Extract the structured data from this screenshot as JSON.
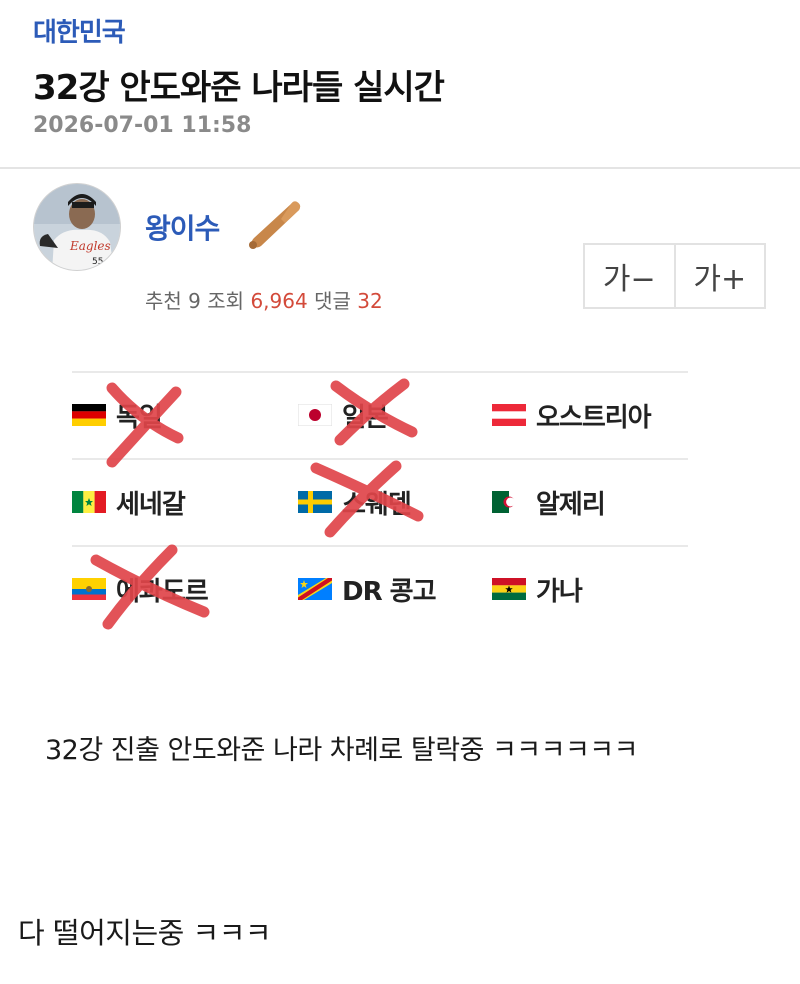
{
  "post": {
    "category": "대한민국",
    "title": "32강 안도와준 나라들 실시간",
    "date": "2026-07-01 11:58"
  },
  "author": {
    "name": "왕이수",
    "badge_icon": "baseball-bat-icon",
    "avatar_icon": "pitcher-photo"
  },
  "stats": {
    "recommend_label": "추천",
    "recommend_value": "9",
    "views_label": "조회",
    "views_value": "6,964",
    "comments_label": "댓글",
    "comments_value": "32"
  },
  "font_controls": {
    "decrease": "가−",
    "increase": "가+"
  },
  "flags": {
    "rows": [
      [
        {
          "name": "독일",
          "flag": "germany",
          "eliminated": true
        },
        {
          "name": "일본",
          "flag": "japan",
          "eliminated": true
        },
        {
          "name": "오스트리아",
          "flag": "austria",
          "eliminated": false
        }
      ],
      [
        {
          "name": "세네갈",
          "flag": "senegal",
          "eliminated": false
        },
        {
          "name": "스웨덴",
          "flag": "sweden",
          "eliminated": true
        },
        {
          "name": "알제리",
          "flag": "algeria",
          "eliminated": false
        }
      ],
      [
        {
          "name": "에콰도르",
          "flag": "ecuador",
          "eliminated": true
        },
        {
          "name": "DR 콩고",
          "flag": "dr-congo",
          "eliminated": false
        },
        {
          "name": "가나",
          "flag": "ghana",
          "eliminated": false
        }
      ]
    ],
    "cross_color": "#e0454a"
  },
  "content": {
    "body": "32강 진출 안도와준 나라 차례로 탈락중 ㅋㅋㅋㅋㅋㅋ",
    "comment": "다 떨어지는중 ㅋㅋㅋ"
  }
}
